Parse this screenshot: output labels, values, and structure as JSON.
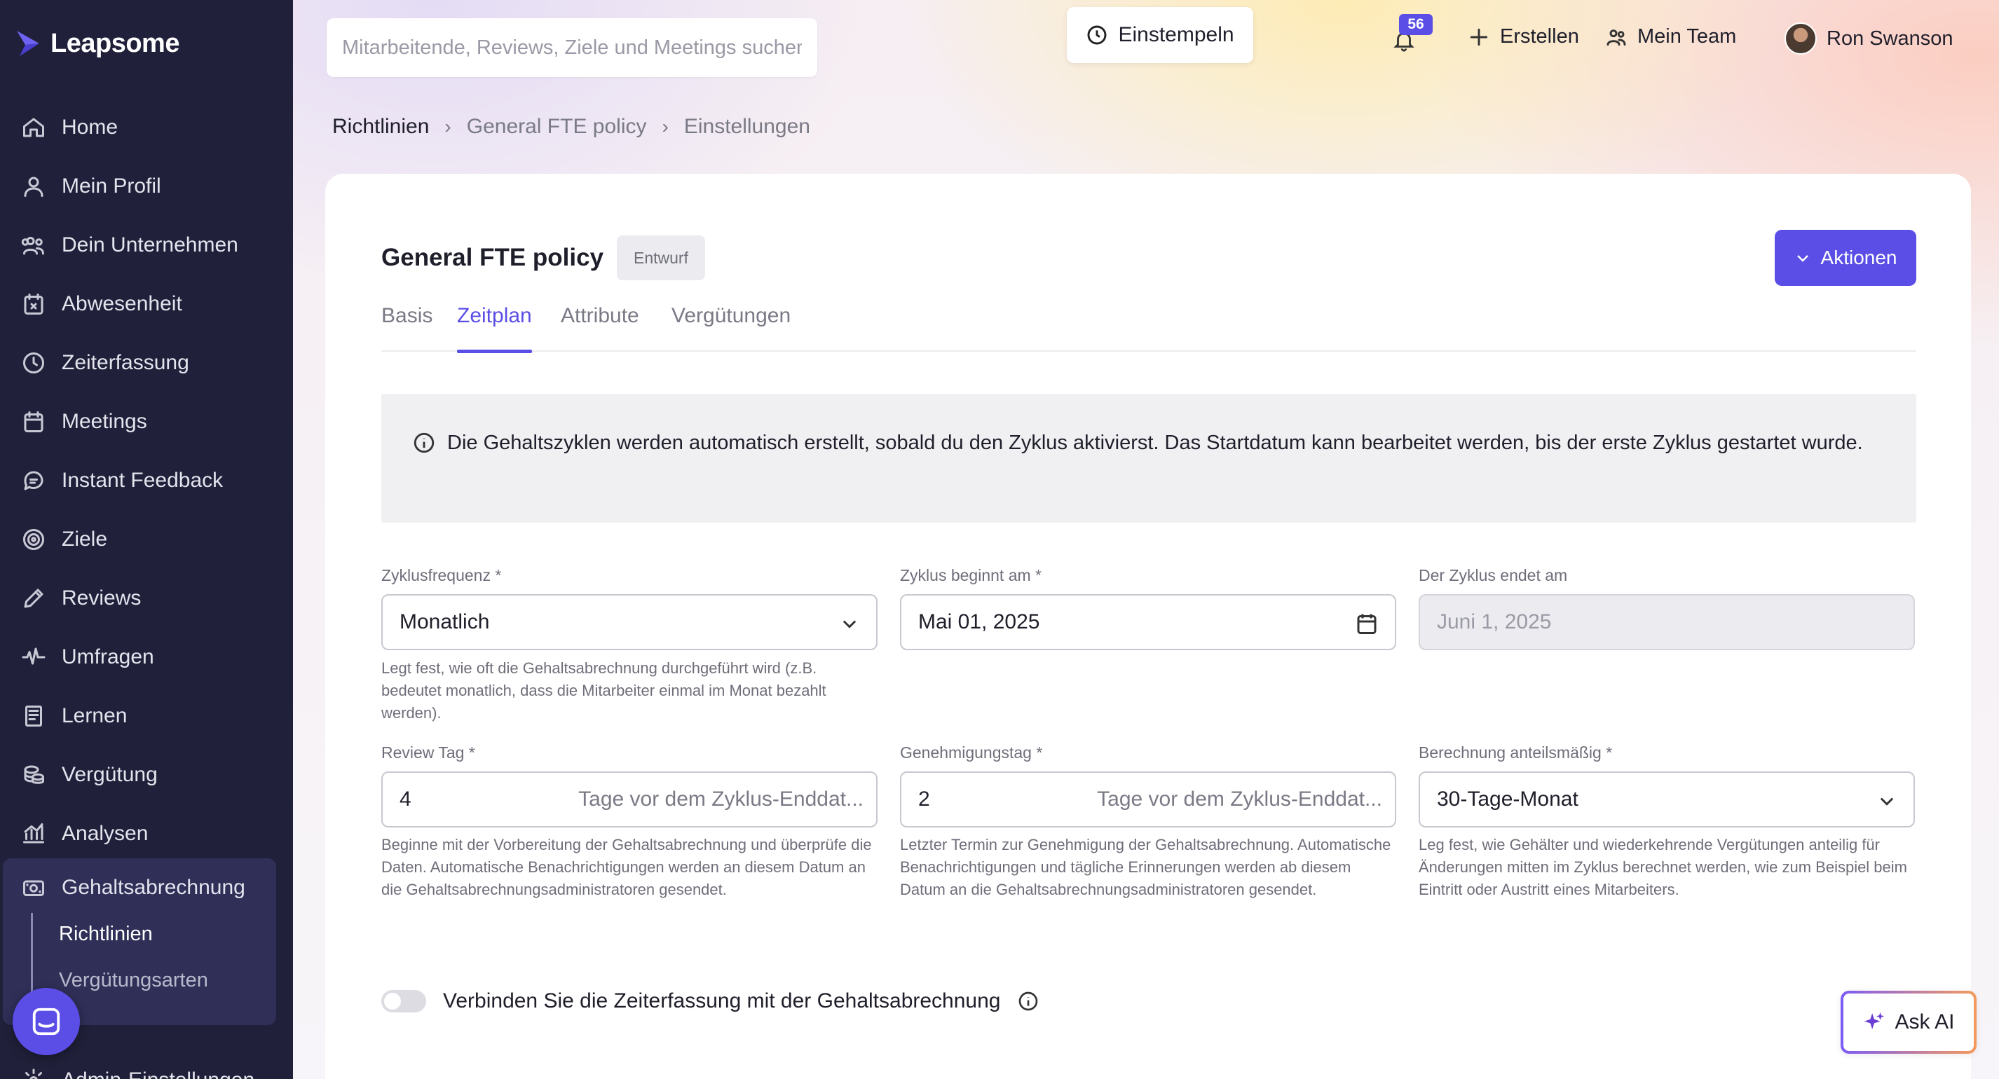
{
  "brand": {
    "name": "Leapsome"
  },
  "sidebar": {
    "items": [
      {
        "label": "Home",
        "icon": "home-icon"
      },
      {
        "label": "Mein Profil",
        "icon": "user-icon"
      },
      {
        "label": "Dein Unternehmen",
        "icon": "people-icon"
      },
      {
        "label": "Abwesenheit",
        "icon": "calendar-x-icon"
      },
      {
        "label": "Zeiterfassung",
        "icon": "clock-icon"
      },
      {
        "label": "Meetings",
        "icon": "calendar-icon"
      },
      {
        "label": "Instant Feedback",
        "icon": "chat-icon"
      },
      {
        "label": "Ziele",
        "icon": "target-icon"
      },
      {
        "label": "Reviews",
        "icon": "pencil-icon"
      },
      {
        "label": "Umfragen",
        "icon": "pulse-icon"
      },
      {
        "label": "Lernen",
        "icon": "book-icon"
      },
      {
        "label": "Vergütung",
        "icon": "coins-icon"
      },
      {
        "label": "Analysen",
        "icon": "chart-icon"
      }
    ],
    "active_group": {
      "label": "Gehaltsabrechnung",
      "icon": "payroll-icon",
      "sub_items": [
        "Richtlinien",
        "Vergütungsarten"
      ]
    },
    "admin_label": "Admin-Einstellungen"
  },
  "topbar": {
    "search_placeholder": "Mitarbeitende, Reviews, Ziele und Meetings suchen",
    "clock_in_label": "Einstempeln",
    "notification_count": "56",
    "create_label": "Erstellen",
    "team_label": "Mein Team",
    "user_name": "Ron Swanson"
  },
  "breadcrumb": [
    "Richtlinien",
    "General FTE policy",
    "Einstellungen"
  ],
  "policy": {
    "title": "General FTE policy",
    "status": "Entwurf",
    "actions_label": "Aktionen",
    "tabs": [
      "Basis",
      "Zeitplan",
      "Attribute",
      "Vergütungen"
    ],
    "active_tab": "Zeitplan",
    "info_text": "Die Gehaltszyklen werden automatisch erstellt, sobald du den Zyklus aktivierst. Das Startdatum kann bearbeitet werden, bis der erste Zyklus gestartet wurde."
  },
  "form": {
    "cycle_frequency": {
      "label": "Zyklusfrequenz *",
      "value": "Monatlich",
      "helper": "Legt fest, wie oft die Gehaltsabrechnung durchgeführt wird (z.B. bedeutet monatlich, dass die Mitarbeiter einmal im Monat bezahlt werden)."
    },
    "cycle_start": {
      "label": "Zyklus beginnt am *",
      "value": "Mai 01, 2025"
    },
    "cycle_end": {
      "label": "Der Zyklus endet am",
      "value": "Juni 1, 2025"
    },
    "review_day": {
      "label": "Review Tag *",
      "value": "4",
      "suffix": "Tage vor dem Zyklus-Enddat...",
      "helper": "Beginne mit der Vorbereitung der Gehaltsabrechnung und überprüfe die Daten. Automatische Benachrichtigungen werden an diesem Datum an die Gehaltsabrechnungsadministratoren gesendet."
    },
    "approval_day": {
      "label": "Genehmigungstag *",
      "value": "2",
      "suffix": "Tage vor dem Zyklus-Enddat...",
      "helper": "Letzter Termin zur Genehmigung der Gehaltsabrechnung. Automatische Benachrichtigungen und tägliche Erinnerungen werden ab diesem Datum an die Gehaltsabrechnungsadministratoren gesendet."
    },
    "proration": {
      "label": "Berechnung anteilsmäßig *",
      "value": "30-Tage-Monat",
      "helper": "Leg fest, wie Gehälter und wiederkehrende Vergütungen anteilig für Änderungen mitten im Zyklus berechnet werden, wie zum Beispiel beim Eintritt oder Austritt eines Mitarbeiters."
    },
    "time_tracking_toggle": {
      "label": "Verbinden Sie die Zeiterfassung mit der Gehaltsabrechnung",
      "enabled": false
    }
  },
  "ask_ai_label": "Ask AI",
  "colors": {
    "accent": "#5b4ee6",
    "sidebar": "#20203a",
    "sidebar_active": "#2f2f58"
  }
}
